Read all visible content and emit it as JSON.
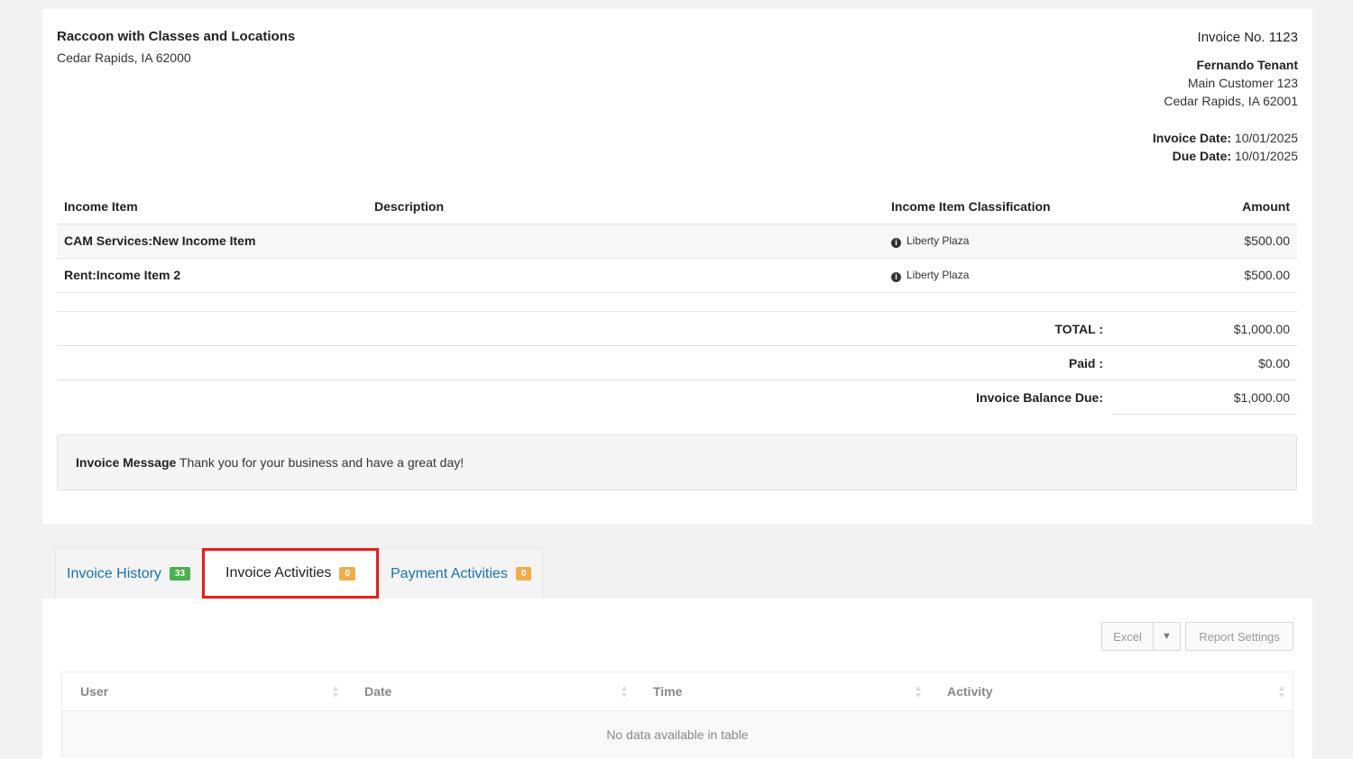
{
  "company": {
    "name": "Raccoon with Classes and Locations",
    "address": "Cedar Rapids, IA 62000"
  },
  "invoice": {
    "number_label": "Invoice No. 1123",
    "customer_name": "Fernando Tenant",
    "customer_line1": "Main Customer 123",
    "customer_line2": "Cedar Rapids, IA 62001",
    "invoice_date_label": "Invoice Date:",
    "invoice_date": "10/01/2025",
    "due_date_label": "Due Date:",
    "due_date": "10/01/2025"
  },
  "items_table": {
    "headers": [
      "Income Item",
      "Description",
      "Income Item Classification",
      "Amount"
    ],
    "rows": [
      {
        "item": "CAM Services:New Income Item",
        "description": "",
        "classification": "Liberty Plaza",
        "amount": "$500.00"
      },
      {
        "item": "Rent:Income Item 2",
        "description": "",
        "classification": "Liberty Plaza",
        "amount": "$500.00"
      }
    ]
  },
  "totals": {
    "total_label": "TOTAL :",
    "total": "$1,000.00",
    "paid_label": "Paid :",
    "paid": "$0.00",
    "balance_label": "Invoice Balance Due:",
    "balance": "$1,000.00"
  },
  "message": {
    "label": "Invoice Message",
    "text": "Thank you for your business and have a great day!"
  },
  "tabs": [
    {
      "label": "Invoice History",
      "count": "33",
      "badge_color": "#4caf50"
    },
    {
      "label": "Invoice Activities",
      "count": "0",
      "badge_color": "#f0ad4e",
      "active": true
    },
    {
      "label": "Payment Activities",
      "count": "0",
      "badge_color": "#f0ad4e"
    }
  ],
  "toolbar": {
    "excel_label": "Excel",
    "caret": "▼",
    "settings_label": "Report Settings"
  },
  "activity_table": {
    "headers": [
      "User",
      "Date",
      "Time",
      "Activity"
    ],
    "empty_text": "No data available in table"
  },
  "colors": {
    "link": "#1a73a8",
    "highlight_border": "#e1201d"
  }
}
